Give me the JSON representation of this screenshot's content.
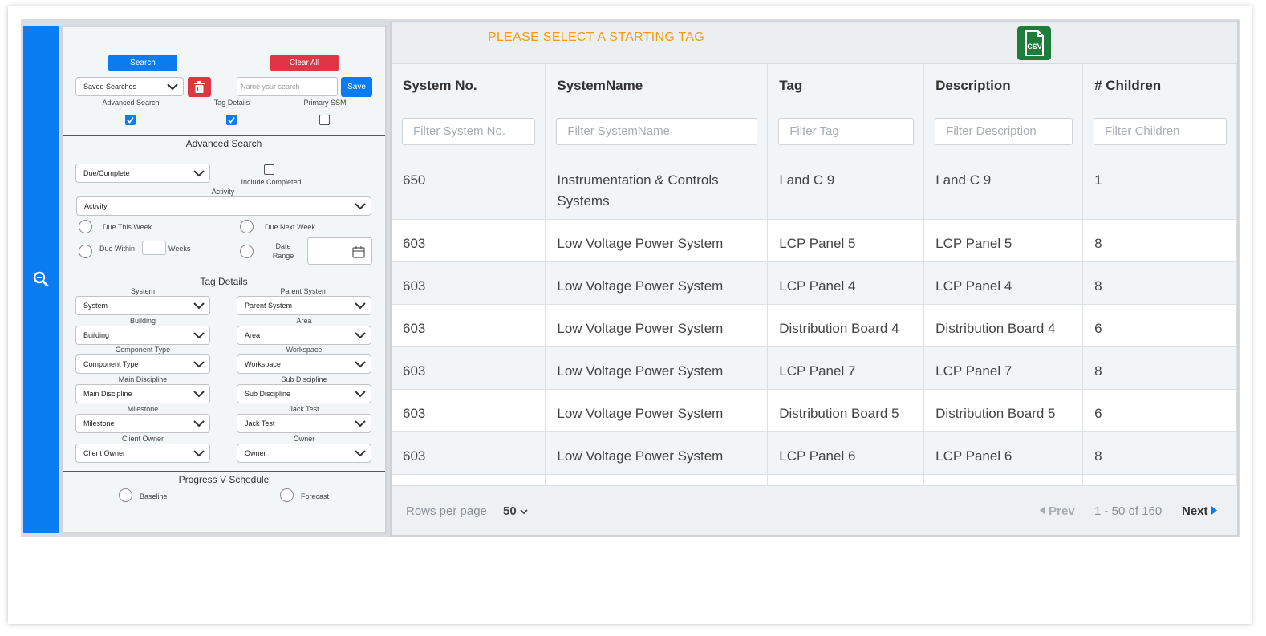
{
  "left_panel": {
    "search_label": "Search",
    "clear_all_label": "Clear All",
    "saved_searches": "Saved Searches",
    "name_search_placeholder": "Name your search",
    "save_label": "Save",
    "toggles": {
      "advanced_search": "Advanced Search",
      "tag_details": "Tag Details",
      "primary_ssm": "Primary SSM"
    },
    "advanced": {
      "title": "Advanced Search",
      "due_complete": "Due/Complete",
      "include_completed": "Include Completed",
      "activity_label": "Activity",
      "activity_value": "Activity",
      "due_this_week": "Due This Week",
      "due_next_week": "Due Next Week",
      "due_within": "Due Within",
      "weeks": "Weeks",
      "date_range_1": "Date",
      "date_range_2": "Range"
    },
    "tag_details": {
      "title": "Tag Details",
      "fields": [
        {
          "label": "System",
          "value": "System"
        },
        {
          "label": "Parent System",
          "value": "Parent System"
        },
        {
          "label": "Building",
          "value": "Building"
        },
        {
          "label": "Area",
          "value": "Area"
        },
        {
          "label": "Component Type",
          "value": "Component Type"
        },
        {
          "label": "Workspace",
          "value": "Workspace"
        },
        {
          "label": "Main Discipline",
          "value": "Main Discipline"
        },
        {
          "label": "Sub Discipline",
          "value": "Sub Discipline"
        },
        {
          "label": "Milestone",
          "value": "Milestone"
        },
        {
          "label": "Jack Test",
          "value": "Jack Test"
        },
        {
          "label": "Client Owner",
          "value": "Client Owner"
        },
        {
          "label": "Owner",
          "value": "Owner"
        }
      ]
    },
    "progress": {
      "title": "Progress V Schedule",
      "baseline": "Baseline",
      "forecast": "Forecast"
    }
  },
  "table": {
    "warning": "PLEASE SELECT A STARTING TAG",
    "csv_label": "CSV",
    "columns": [
      "System No.",
      "SystemName",
      "Tag",
      "Description",
      "# Children"
    ],
    "filters": [
      "Filter System No.",
      "Filter SystemName",
      "Filter Tag",
      "Filter Description",
      "Filter Children"
    ],
    "rows": [
      [
        "650",
        "Instrumentation & Controls Systems",
        "I and C 9",
        "I and C 9",
        "1"
      ],
      [
        "603",
        "Low Voltage Power System",
        "LCP Panel 5",
        "LCP Panel 5",
        "8"
      ],
      [
        "603",
        "Low Voltage Power System",
        "LCP Panel 4",
        "LCP Panel 4",
        "8"
      ],
      [
        "603",
        "Low Voltage Power System",
        "Distribution Board 4",
        "Distribution Board 4",
        "6"
      ],
      [
        "603",
        "Low Voltage Power System",
        "LCP Panel 7",
        "LCP Panel 7",
        "8"
      ],
      [
        "603",
        "Low Voltage Power System",
        "Distribution Board 5",
        "Distribution Board 5",
        "6"
      ],
      [
        "603",
        "Low Voltage Power System",
        "LCP Panel 6",
        "LCP Panel 6",
        "8"
      ]
    ],
    "footer": {
      "rows_per_page_label": "Rows per page",
      "rows_per_page_value": "50",
      "prev": "Prev",
      "range": "1 - 50 of 160",
      "next": "Next"
    }
  }
}
